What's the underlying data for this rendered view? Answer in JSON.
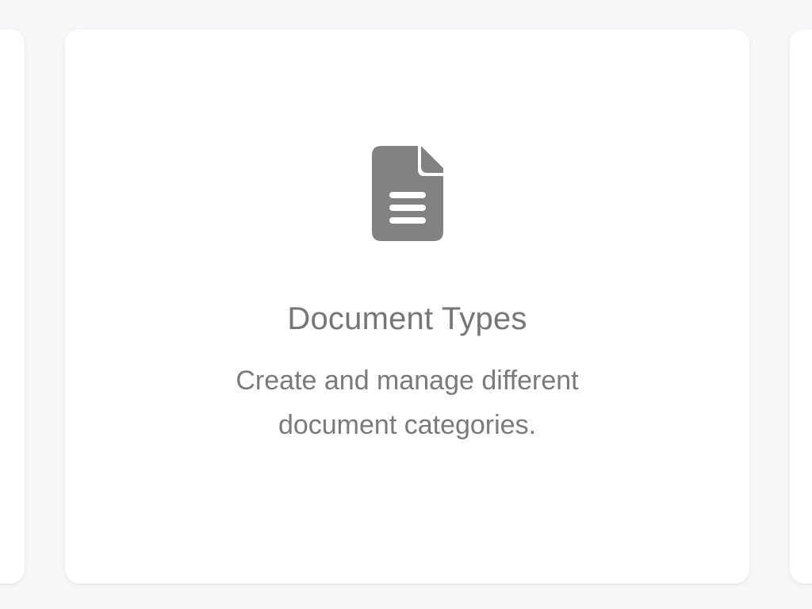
{
  "card": {
    "title": "Document Types",
    "description": "Create and manage different document categories.",
    "icon": "document-icon"
  },
  "colors": {
    "background": "#f7f8fa",
    "card": "#ffffff",
    "icon": "#828282",
    "text": "#767676"
  }
}
